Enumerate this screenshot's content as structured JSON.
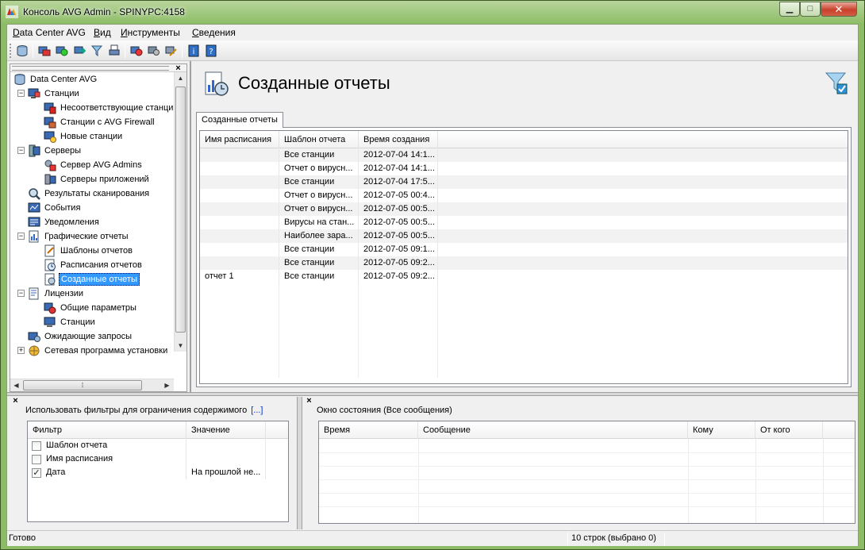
{
  "window": {
    "title": "Консоль AVG Admin - SPINYPC:4158",
    "minimize": "▁",
    "maximize": "□",
    "close": "✕"
  },
  "menu": [
    "Data Center AVG",
    "Вид",
    "Инструменты",
    "Сведения"
  ],
  "toolbar_icons": [
    "database-icon",
    "stations-icon",
    "refresh-icon",
    "export-icon",
    "filter-icon",
    "print-icon",
    "alert-icon",
    "settings-icon",
    "edit-icon",
    "info-icon",
    "help-icon"
  ],
  "tree": {
    "root": "Data Center AVG",
    "items": [
      {
        "label": "Станции",
        "icon": "stations-icon"
      },
      {
        "label": "Несоответствующие станции",
        "icon": "station-warning-icon"
      },
      {
        "label": "Станции с AVG Firewall",
        "icon": "station-firewall-icon"
      },
      {
        "label": "Новые станции",
        "icon": "station-new-icon"
      },
      {
        "label": "Серверы",
        "icon": "servers-icon"
      },
      {
        "label": "Сервер AVG Admins",
        "icon": "server-admin-icon"
      },
      {
        "label": "Серверы приложений",
        "icon": "server-app-icon"
      },
      {
        "label": "Результаты сканирования",
        "icon": "scan-results-icon"
      },
      {
        "label": "События",
        "icon": "events-icon"
      },
      {
        "label": "Уведомления",
        "icon": "notifications-icon"
      },
      {
        "label": "Графические отчеты",
        "icon": "graphic-reports-icon"
      },
      {
        "label": "Шаблоны отчетов",
        "icon": "report-templates-icon"
      },
      {
        "label": "Расписания отчетов",
        "icon": "report-schedules-icon"
      },
      {
        "label": "Созданные отчеты",
        "icon": "created-reports-icon"
      },
      {
        "label": "Лицензии",
        "icon": "licenses-icon"
      },
      {
        "label": "Общие параметры",
        "icon": "general-params-icon"
      },
      {
        "label": "Станции",
        "icon": "license-stations-icon"
      },
      {
        "label": "Ожидающие запросы",
        "icon": "pending-requests-icon"
      },
      {
        "label": "Сетевая программа установки",
        "icon": "network-installer-icon"
      }
    ]
  },
  "main": {
    "title": "Созданные отчеты",
    "tab": "Созданные отчеты",
    "columns": [
      "Имя расписания",
      "Шаблон отчета",
      "Время создания"
    ],
    "rows": [
      [
        "",
        "Все станции",
        "2012-07-04 14:1..."
      ],
      [
        "",
        "Отчет о вирусн...",
        "2012-07-04 14:1..."
      ],
      [
        "",
        "Все станции",
        "2012-07-04 17:5..."
      ],
      [
        "",
        "Отчет о вирусн...",
        "2012-07-05 00:4..."
      ],
      [
        "",
        "Отчет о вирусн...",
        "2012-07-05 00:5..."
      ],
      [
        "",
        "Вирусы на стан...",
        "2012-07-05 00:5..."
      ],
      [
        "",
        "Наиболее зара...",
        "2012-07-05 00:5..."
      ],
      [
        "",
        "Все станции",
        "2012-07-05 09:1..."
      ],
      [
        "",
        "Все станции",
        "2012-07-05 09:2..."
      ],
      [
        "отчет 1",
        "Все станции",
        "2012-07-05 09:2..."
      ]
    ]
  },
  "filter_panel": {
    "label": "Использовать фильтры для ограничения содержимого",
    "link": "[...]",
    "columns": [
      "Фильтр",
      "Значение"
    ],
    "rows": [
      {
        "name": "Шаблон отчета",
        "checked": false,
        "value": ""
      },
      {
        "name": "Имя расписания",
        "checked": false,
        "value": ""
      },
      {
        "name": "Дата",
        "checked": true,
        "value": "На прошлой не..."
      }
    ]
  },
  "status_panel": {
    "title": "Окно состояния (Все сообщения)",
    "columns": [
      "Время",
      "Сообщение",
      "Кому",
      "От кого"
    ]
  },
  "statusbar": {
    "left": "Готово",
    "right": "10 строк (выбрано 0)"
  },
  "colors": {
    "window_frame": "#8cbc65",
    "selection": "#3399ff",
    "link": "#0033cc"
  }
}
